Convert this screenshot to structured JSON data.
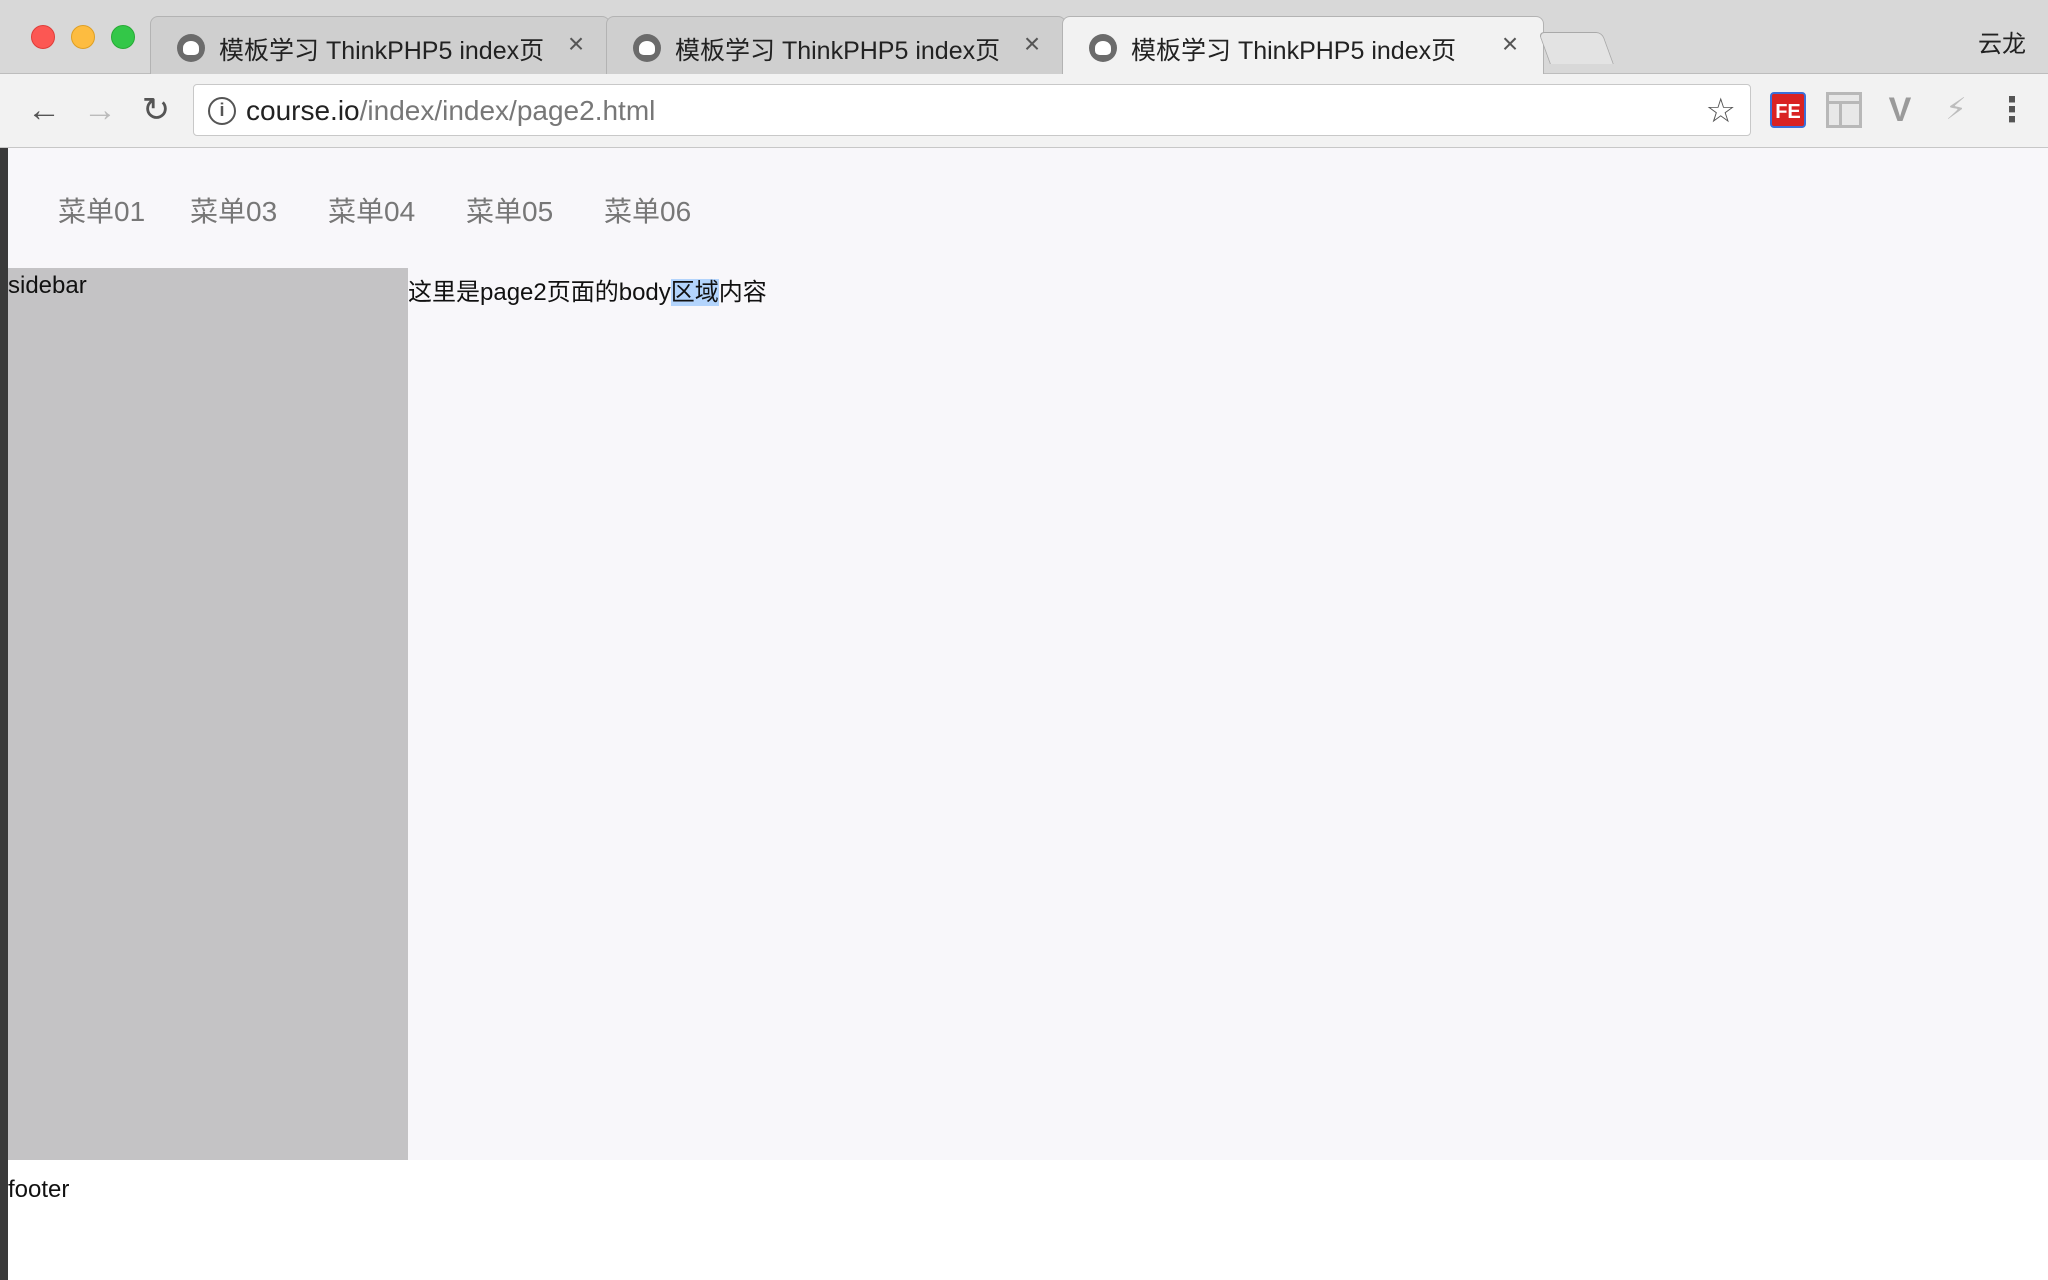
{
  "browser": {
    "profile_name": "云龙",
    "tabs": [
      {
        "title": "模板学习 ThinkPHP5 index页",
        "active": false
      },
      {
        "title": "模板学习 ThinkPHP5 index页",
        "active": false
      },
      {
        "title": "模板学习 ThinkPHP5 index页",
        "active": true
      }
    ],
    "address": {
      "host": "course.io",
      "path": "/index/index/page2.html"
    },
    "extensions": {
      "fe_label": "FE"
    }
  },
  "page": {
    "nav_items": [
      "菜单01",
      "菜单03",
      "菜单04",
      "菜单05",
      "菜单06"
    ],
    "sidebar_label": "sidebar",
    "body_before": "这里是page2页面的body",
    "body_selected": "区域",
    "body_after": "内容",
    "footer_label": "footer"
  },
  "colors": {
    "sidebar_bg": "#c4c3c5",
    "page_bg": "#f8f7fa",
    "selection": "#b3d4fc",
    "nav_text": "#777777"
  }
}
